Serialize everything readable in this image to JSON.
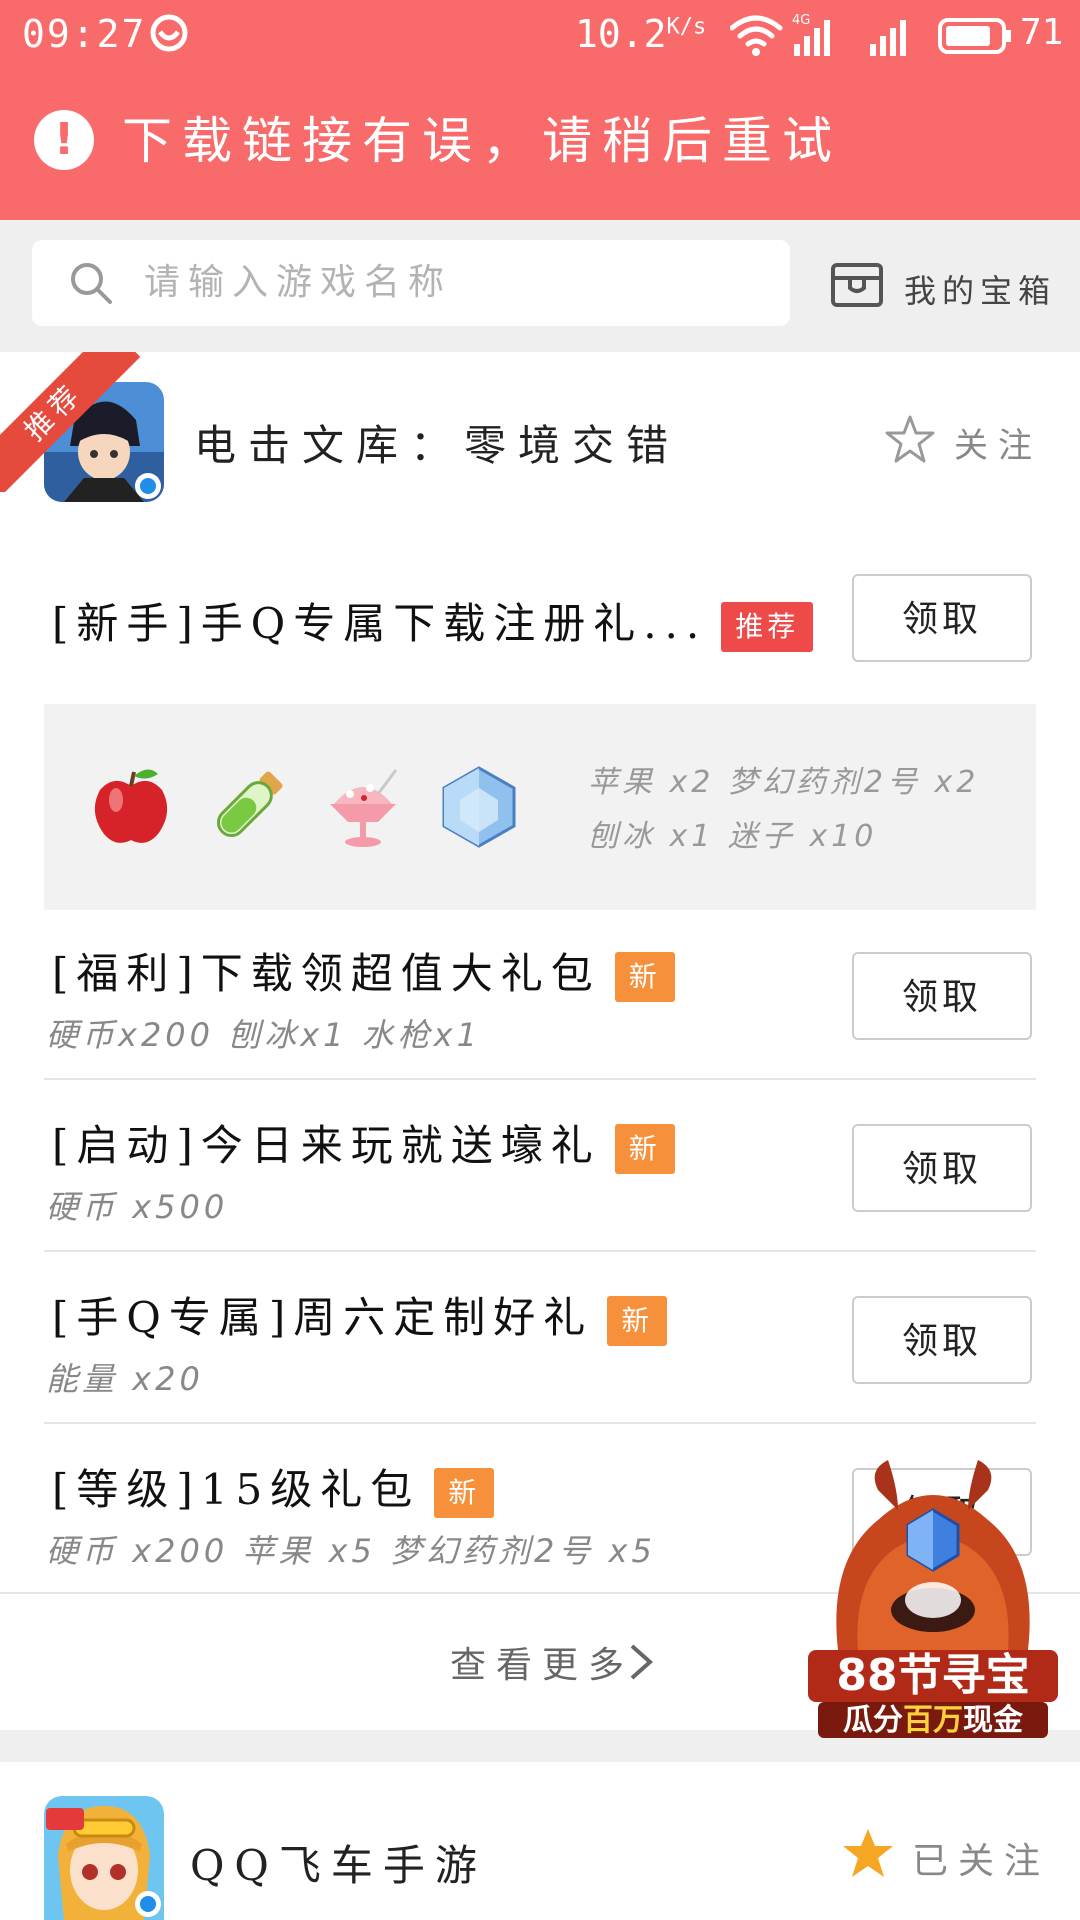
{
  "status_bar": {
    "time": "09:27",
    "network_speed": "10.2",
    "network_speed_unit": "K/s",
    "network_type": "4G",
    "battery_level": "71"
  },
  "alert": {
    "message": "下载链接有误，请稍后重试"
  },
  "search": {
    "placeholder": "请输入游戏名称",
    "treasure_label": "我的宝箱"
  },
  "game1": {
    "ribbon": "推荐",
    "title": "电击文库：零境交错",
    "follow_label": "关注",
    "gifts": [
      {
        "title": "[新手]手Q专属下载注册礼...",
        "badge": "推荐",
        "claim": "领取",
        "items": [
          {
            "name": "苹果",
            "icon": "apple-icon"
          },
          {
            "name": "梦幻药剂2号",
            "icon": "potion-icon"
          },
          {
            "name": "刨冰",
            "icon": "shaved-ice-icon"
          },
          {
            "name": "迷子",
            "icon": "crystal-icon"
          }
        ],
        "items_line1": "苹果 x2 梦幻药剂2号 x2",
        "items_line2": "刨冰 x1 迷子 x10"
      },
      {
        "title": "[福利]下载领超值大礼包",
        "badge": "新",
        "desc": "硬币x200 刨冰x1 水枪x1",
        "claim": "领取"
      },
      {
        "title": "[启动]今日来玩就送壕礼",
        "badge": "新",
        "desc": "硬币 x500",
        "claim": "领取"
      },
      {
        "title": "[手Q专属]周六定制好礼",
        "badge": "新",
        "desc": "能量 x20",
        "claim": "领取"
      },
      {
        "title": "[等级]15级礼包",
        "badge": "新",
        "desc": "硬币 x200 苹果 x5 梦幻药剂2号 x5",
        "claim": "领取"
      }
    ],
    "more_label": "查看更多"
  },
  "promo": {
    "line1": "88节寻宝",
    "line2_prefix": "瓜分",
    "line2_highlight": "百万",
    "line2_suffix": "现金"
  },
  "game2": {
    "title": "QQ飞车手游",
    "followed_label": "已关注"
  },
  "colors": {
    "banner": "#f96b6b",
    "badge_red": "#ef4a4a",
    "badge_orange": "#f7903a",
    "star_gold": "#f5a623"
  }
}
